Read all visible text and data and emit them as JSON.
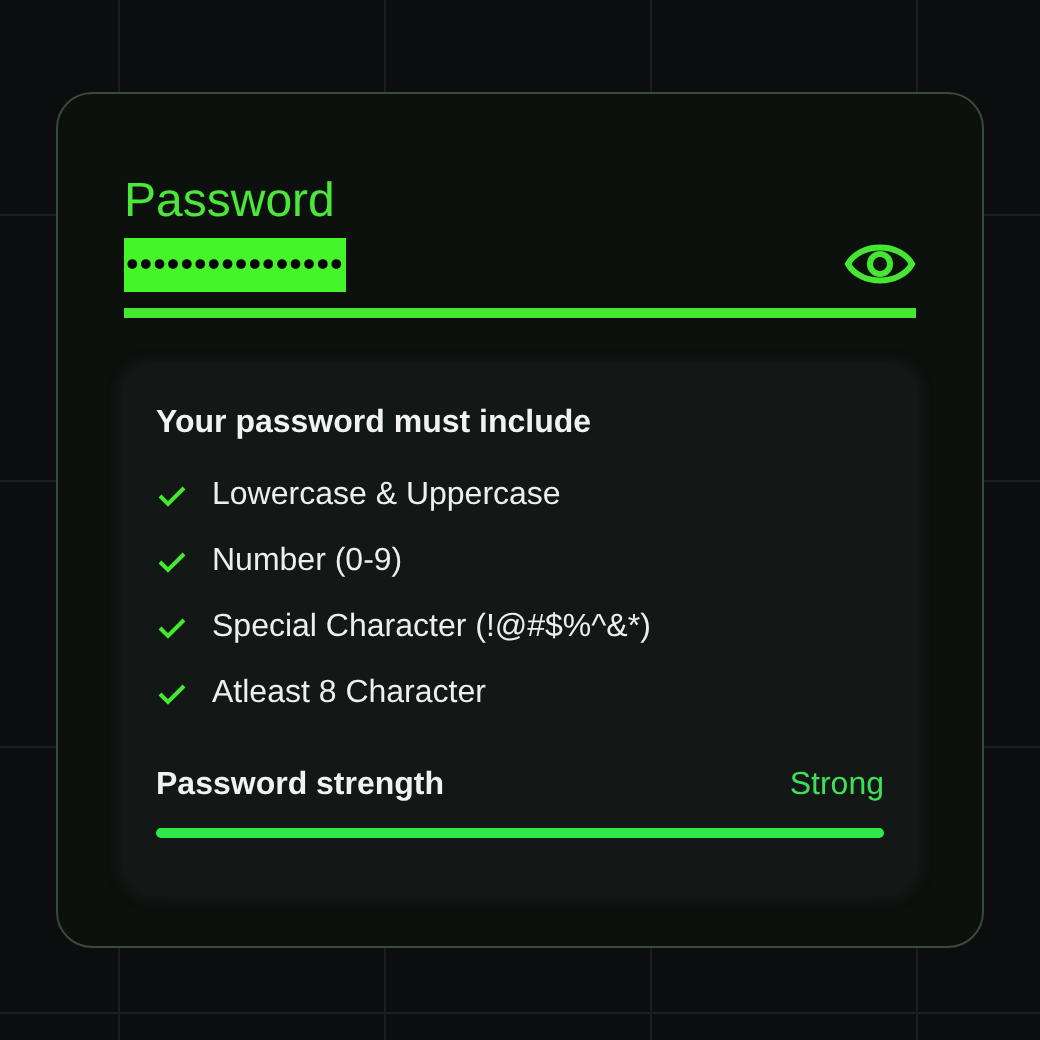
{
  "password_field": {
    "label": "Password",
    "value": "••••••••••••••••",
    "selected": true,
    "focused": true
  },
  "requirements": {
    "title": "Your password must include",
    "items": [
      {
        "label": "Lowercase & Uppercase",
        "checked": true
      },
      {
        "label": "Number (0-9)",
        "checked": true
      },
      {
        "label": "Special Character (!@#$%^&*)",
        "checked": true
      },
      {
        "label": "Atleast 8 Character",
        "checked": true
      }
    ]
  },
  "strength": {
    "label": "Password strength",
    "reading": "Strong",
    "level": 1
  }
}
